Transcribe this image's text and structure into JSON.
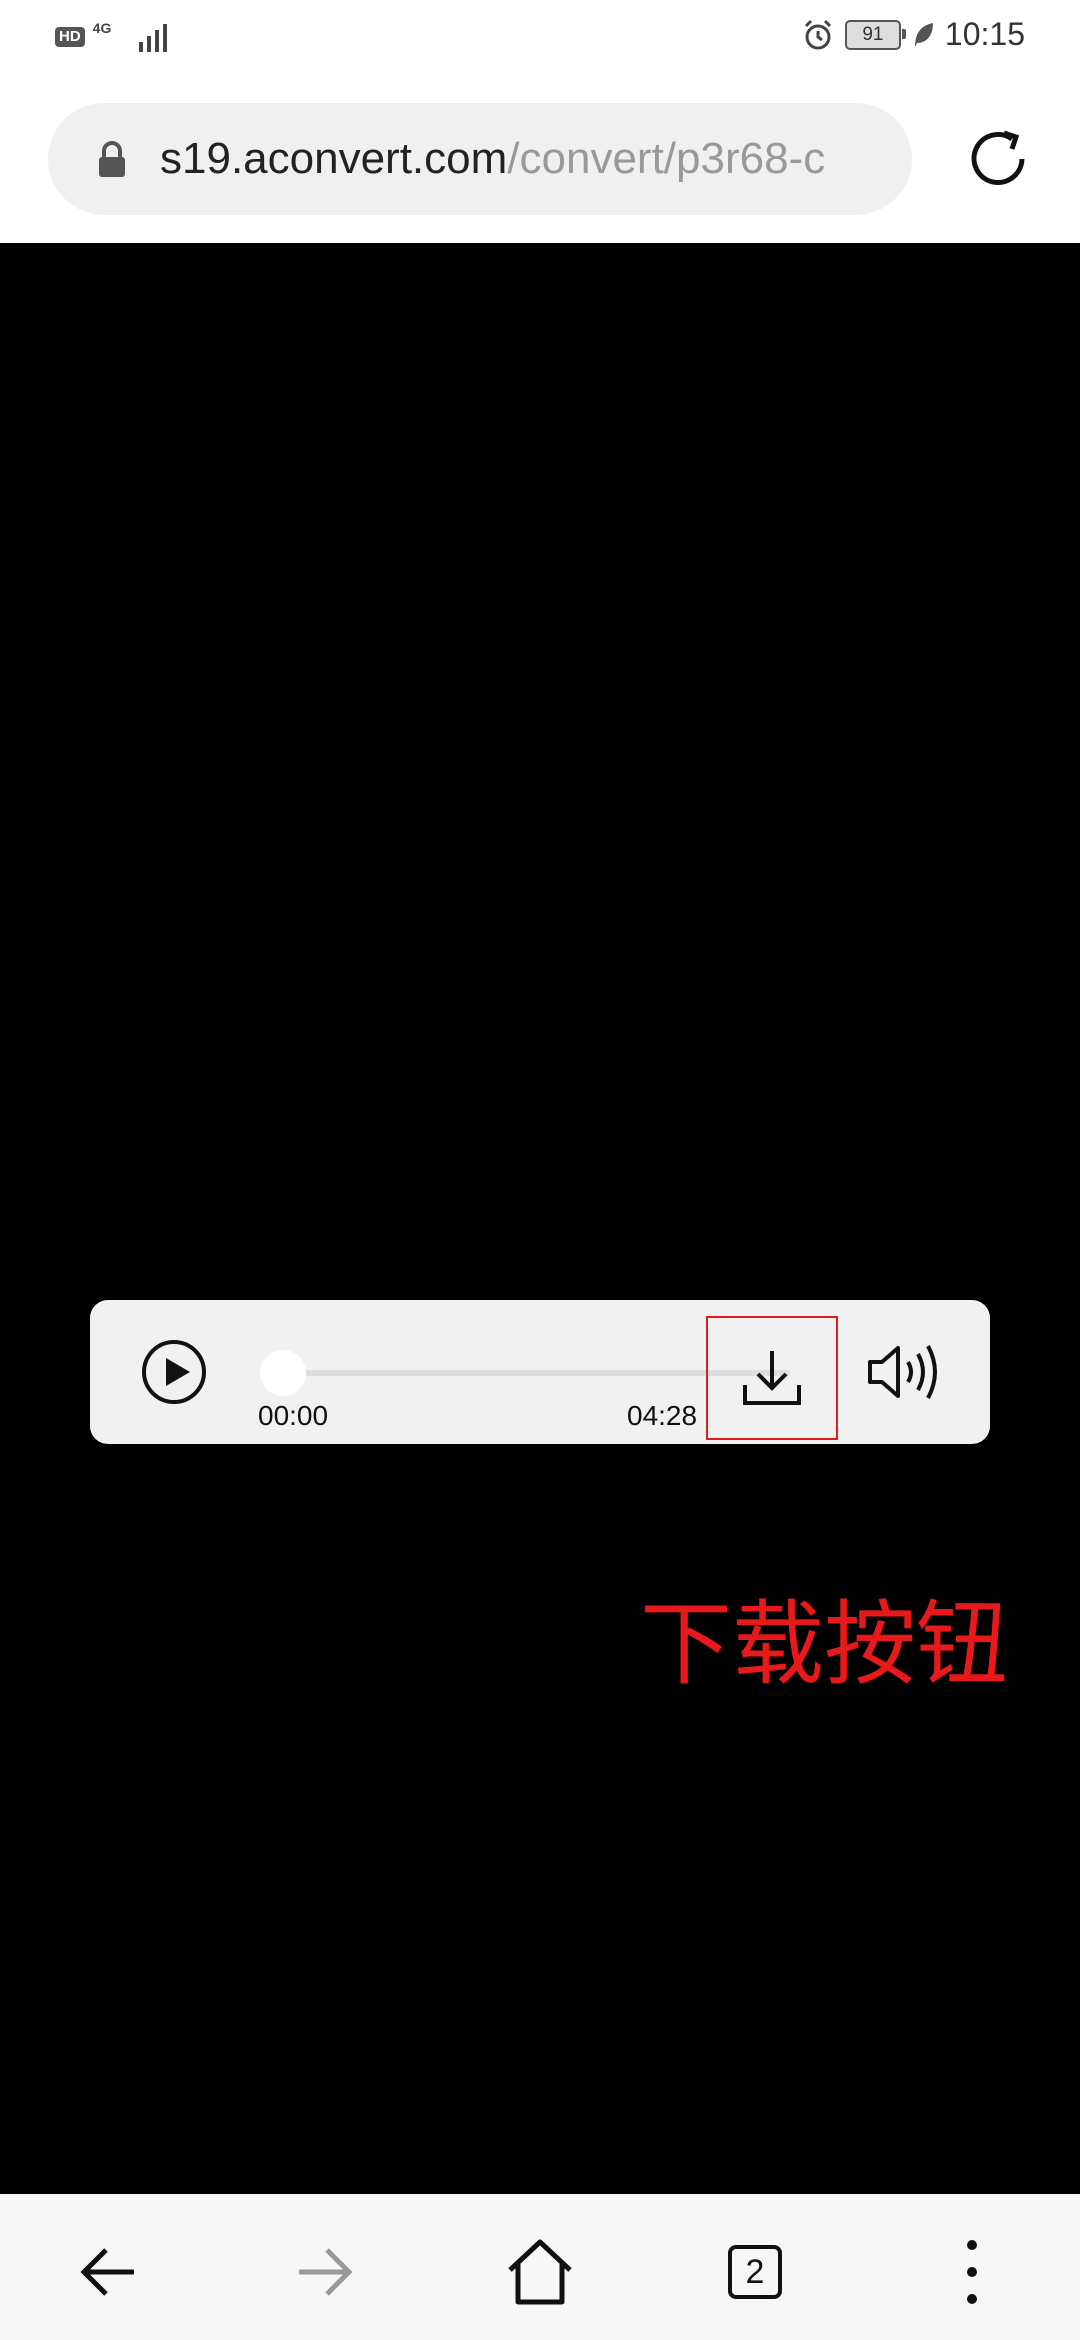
{
  "status_bar": {
    "hd_label": "HD",
    "network_label": "4G",
    "battery_level": "91",
    "time": "10:15"
  },
  "browser": {
    "url_host": "s19.aconvert.com",
    "url_path": "/convert/p3r68-c",
    "tabs_count": "2"
  },
  "player": {
    "current_time": "00:00",
    "total_time": "04:28",
    "progress": 0
  },
  "annotation": {
    "text": "下载按钮",
    "color": "#e8191b"
  },
  "colors": {
    "page_background": "#000000",
    "player_background": "#f1f1f1",
    "highlight": "#e8191b"
  }
}
